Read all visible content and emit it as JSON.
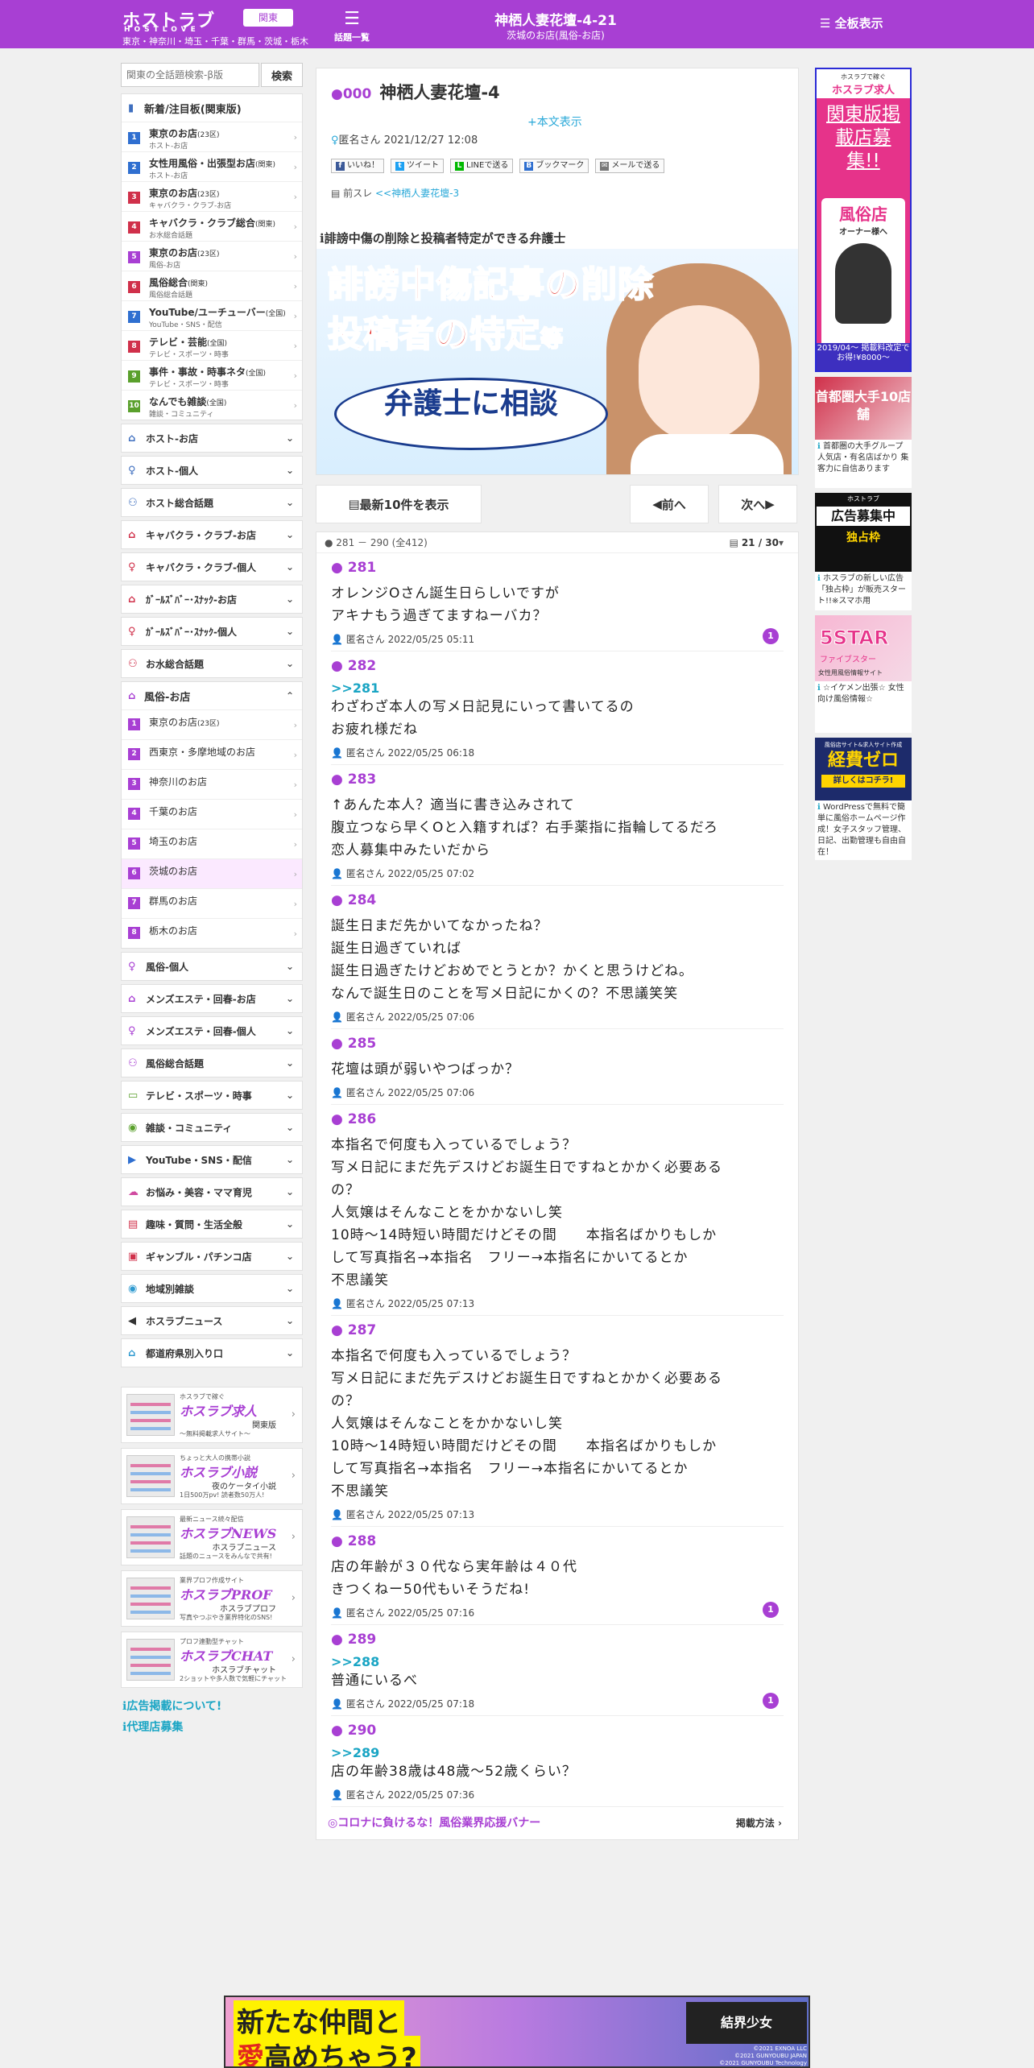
{
  "header": {
    "logo": "ホストラブ",
    "logo_sub": "HOSTLOVE",
    "region_btn": "関東",
    "cities": "東京・神奈川・埼玉・千葉・群馬・茨城・栃木",
    "topics_label": "話題一覧",
    "title": "神栖人妻花壇-4-21",
    "subtitle": "茨城のお店(風俗-お店)",
    "all_boards": "全板表示"
  },
  "search": {
    "placeholder": "関東の全話題検索-β版",
    "button": "検索"
  },
  "new_box": {
    "title": "新着/注目板(関東版)",
    "items": [
      {
        "num": "1",
        "color": "#2f6fd0",
        "title": "東京のお店",
        "tag": "(23区)",
        "sub": "ホスト-お店"
      },
      {
        "num": "2",
        "color": "#2f6fd0",
        "title": "女性用風俗・出張型お店",
        "tag": "(関東)",
        "sub": "ホスト-お店"
      },
      {
        "num": "3",
        "color": "#d0304a",
        "title": "東京のお店",
        "tag": "(23区)",
        "sub": "キャバクラ・クラブ-お店"
      },
      {
        "num": "4",
        "color": "#d0304a",
        "title": "キャバクラ・クラブ総合",
        "tag": "(関東)",
        "sub": "お水総合話題"
      },
      {
        "num": "5",
        "color": "#a83fd3",
        "title": "東京のお店",
        "tag": "(23区)",
        "sub": "風俗-お店"
      },
      {
        "num": "6",
        "color": "#d0304a",
        "title": "風俗総合",
        "tag": "(関東)",
        "sub": "風俗総合話題"
      },
      {
        "num": "7",
        "color": "#2f6fd0",
        "title": "YouTube/ユーチューバー",
        "tag": "(全国)",
        "sub": "YouTube・SNS・配信"
      },
      {
        "num": "8",
        "color": "#d0304a",
        "title": "テレビ・芸能",
        "tag": "(全国)",
        "sub": "テレビ・スポーツ・時事"
      },
      {
        "num": "9",
        "color": "#5aa02c",
        "title": "事件・事故・時事ネタ",
        "tag": "(全国)",
        "sub": "テレビ・スポーツ・時事"
      },
      {
        "num": "10",
        "color": "#5aa02c",
        "title": "なんでも雑談",
        "tag": "(全国)",
        "sub": "雑談・コミュニティ"
      }
    ]
  },
  "categories_top": [
    {
      "label": "ホスト-お店",
      "icon": "house",
      "color": "#3f6fbf"
    },
    {
      "label": "ホスト-個人",
      "icon": "person",
      "color": "#3f6fbf"
    },
    {
      "label": "ホスト総合話題",
      "icon": "group",
      "color": "#3f6fbf"
    },
    {
      "label": "キャバクラ・クラブ-お店",
      "icon": "house",
      "color": "#d0304a"
    },
    {
      "label": "キャバクラ・クラブ-個人",
      "icon": "person",
      "color": "#d0304a"
    },
    {
      "label": "ｶﾞｰﾙｽﾞﾊﾞｰ･ｽﾅｯｸ-お店",
      "icon": "house",
      "color": "#d0304a"
    },
    {
      "label": "ｶﾞｰﾙｽﾞﾊﾞｰ･ｽﾅｯｸ-個人",
      "icon": "person",
      "color": "#d0304a"
    },
    {
      "label": "お水総合話題",
      "icon": "group",
      "color": "#d0304a"
    }
  ],
  "fuzoku_box": {
    "title": "風俗-お店",
    "items": [
      {
        "num": "1",
        "title": "東京のお店",
        "tag": "(23区)"
      },
      {
        "num": "2",
        "title": "西東京・多摩地域のお店",
        "tag": ""
      },
      {
        "num": "3",
        "title": "神奈川のお店",
        "tag": ""
      },
      {
        "num": "4",
        "title": "千葉のお店",
        "tag": ""
      },
      {
        "num": "5",
        "title": "埼玉のお店",
        "tag": ""
      },
      {
        "num": "6",
        "title": "茨城のお店",
        "tag": ""
      },
      {
        "num": "7",
        "title": "群馬のお店",
        "tag": ""
      },
      {
        "num": "8",
        "title": "栃木のお店",
        "tag": ""
      }
    ]
  },
  "categories_bottom": [
    {
      "label": "風俗-個人",
      "icon": "person",
      "color": "#a83fd3"
    },
    {
      "label": "メンズエステ・回春-お店",
      "icon": "house",
      "color": "#a83fd3"
    },
    {
      "label": "メンズエステ・回春-個人",
      "icon": "person",
      "color": "#a83fd3"
    },
    {
      "label": "風俗総合話題",
      "icon": "group",
      "color": "#a83fd3"
    },
    {
      "label": "テレビ・スポーツ・時事",
      "icon": "tv",
      "color": "#5aa02c"
    },
    {
      "label": "雑談・コミュニティ",
      "icon": "chat",
      "color": "#5aa02c"
    },
    {
      "label": "YouTube・SNS・配信",
      "icon": "youtube",
      "color": "#2f6fd0"
    },
    {
      "label": "お悩み・美容・ママ育児",
      "icon": "cloud",
      "color": "#d04aa0"
    },
    {
      "label": "趣味・質問・生活全般",
      "icon": "list",
      "color": "#d0304a"
    },
    {
      "label": "ギャンブル・パチンコ店",
      "icon": "slot",
      "color": "#d0304a"
    },
    {
      "label": "地域別雑談",
      "icon": "chat",
      "color": "#2f9ad0"
    },
    {
      "label": "ホスラブニュース",
      "icon": "speaker",
      "color": "#333"
    },
    {
      "label": "都道府県別入り口",
      "icon": "house",
      "color": "#2f9ad0"
    }
  ],
  "services": [
    {
      "c1": "ホスラブで稼ぐ",
      "c2": "ホスラブ求人",
      "c3": "関東版",
      "c4": "〜無料掲載求人サイト〜"
    },
    {
      "c1": "ちょっと大人の携帯小説",
      "c2": "ホスラブ小説",
      "c3": "夜のケータイ小説",
      "c4": "1日500万pv! 読者数50万人!"
    },
    {
      "c1": "最新ニュース続々配信",
      "c2": "ホスラブNEWS",
      "c3": "ホスラブニュース",
      "c4": "話題のニュースをみんなで共有!"
    },
    {
      "c1": "業界プロフ作成サイト",
      "c2": "ホスラブPROF",
      "c3": "ホスラブプロフ",
      "c4": "写真やつぶやき業界特化のSNS!"
    },
    {
      "c1": "プロフ連動型チャット",
      "c2": "ホスラブCHAT",
      "c3": "ホスラブチャット",
      "c4": "2ショットや多人数で気軽にチャット"
    }
  ],
  "info_links": [
    "広告掲載について!",
    "代理店募集"
  ],
  "thread": {
    "id": "000",
    "title": "神栖人妻花壇-4",
    "more": "+本文表示",
    "author": "匿名さん",
    "date": "2021/12/27 12:08",
    "prev_label": "前スレ",
    "prev_link": "<<神栖人妻花壇-3",
    "socials": [
      "いいね！",
      "ツイート",
      "LINEで送る",
      "ブックマーク",
      "メールで送る"
    ]
  },
  "banner": {
    "caption": "誹謗中傷の削除と投稿者特定ができる弁護士",
    "line1": "誹謗中傷記事の削除",
    "line2": "投稿者の特定",
    "line2_suffix": "等",
    "oval": "弁護士に相談"
  },
  "nav": {
    "latest": "最新10件を表示",
    "prev": "前へ",
    "next": "次へ"
  },
  "posts_head": {
    "range": "281 － 290",
    "total": "(全412)",
    "page": "21 / 30"
  },
  "posts": [
    {
      "num": "281",
      "reply": "",
      "body": "オレンジOさん誕生日らしいですが\nアキナもう過ぎてますねーバカ？",
      "author": "匿名さん",
      "date": "2022/05/25 05:11",
      "badge": "1"
    },
    {
      "num": "282",
      "reply": ">>281",
      "body": "わざわざ本人の写メ日記見にいって書いてるの\nお疲れ様だね",
      "author": "匿名さん",
      "date": "2022/05/25 06:18",
      "badge": ""
    },
    {
      "num": "283",
      "reply": "",
      "body": "↑あんた本人？適当に書き込みされて\n腹立つなら早くOと入籍すれば？右手薬指に指輪してるだろ\n恋人募集中みたいだから",
      "author": "匿名さん",
      "date": "2022/05/25 07:02",
      "badge": ""
    },
    {
      "num": "284",
      "reply": "",
      "body": "誕生日まだ先かいてなかったね？\n誕生日過ぎていれば\n誕生日過ぎたけどおめでとうとか？かくと思うけどね。\nなんで誕生日のことを写メ日記にかくの？不思議笑笑",
      "author": "匿名さん",
      "date": "2022/05/25 07:06",
      "badge": ""
    },
    {
      "num": "285",
      "reply": "",
      "body": "花壇は頭が弱いやつばっか？",
      "author": "匿名さん",
      "date": "2022/05/25 07:06",
      "badge": ""
    },
    {
      "num": "286",
      "reply": "",
      "body": "本指名で何度も入っているでしょう？\n写メ日記にまだ先デスけどお誕生日ですねとかかく必要ある\nの？\n人気嬢はそんなことをかかないし笑\n10時〜14時短い時間だけどその間　　本指名ばかりもしか\nして写真指名→本指名　フリー→本指名にかいてるとか\n不思議笑",
      "author": "匿名さん",
      "date": "2022/05/25 07:13",
      "badge": ""
    },
    {
      "num": "287",
      "reply": "",
      "body": "本指名で何度も入っているでしょう？\n写メ日記にまだ先デスけどお誕生日ですねとかかく必要ある\nの？\n人気嬢はそんなことをかかないし笑\n10時〜14時短い時間だけどその間　　本指名ばかりもしか\nして写真指名→本指名　フリー→本指名にかいてるとか\n不思議笑",
      "author": "匿名さん",
      "date": "2022/05/25 07:13",
      "badge": ""
    },
    {
      "num": "288",
      "reply": "",
      "body": "店の年齢が３０代なら実年齢は４０代\nきつくねー50代もいそうだね!",
      "author": "匿名さん",
      "date": "2022/05/25 07:16",
      "badge": "1"
    },
    {
      "num": "289",
      "reply": ">>288",
      "body": "普通にいるべ",
      "author": "匿名さん",
      "date": "2022/05/25 07:18",
      "badge": "1"
    },
    {
      "num": "290",
      "reply": ">>289",
      "body": "店の年齢38歳は48歳〜52歳くらい？",
      "author": "匿名さん",
      "date": "2022/05/25 07:36",
      "badge": ""
    }
  ],
  "corona": {
    "text": "◎コロナに負けるな！風俗業界応援バナー",
    "method": "掲載方法"
  },
  "right_ads": [
    {
      "title_small": "ホスラブで稼ぐ",
      "brand": "ホスラブ求人",
      "head": "関東版掲載店募集!!",
      "tag": "風俗店",
      "tag2": "オーナー様へ",
      "price": "2019/04〜 掲載料改定で お得!¥8000〜",
      "caption": ""
    },
    {
      "title_small": "首都圏大手",
      "brand": "",
      "head": "首都圏大手10店舗",
      "caption": "首都圏の大手グループ 人気店・有名店ばかり 集客力に自信あります"
    },
    {
      "title_small": "独占枠",
      "brand": "ホストラブ",
      "head": "広告募集中",
      "caption": "ホスラブの新しい広告「独占枠」が販売スタート!!※スマホ用"
    },
    {
      "title_small": "女性用風俗情報サイト",
      "brand": "5STAR",
      "head": "ファイブスター",
      "caption": "☆イケメン出張☆ 女性向け風俗情報☆"
    },
    {
      "title_small": "風俗店サイト&求人サイト作成",
      "brand": "経費ゼロ",
      "head": "詳しくはコチラ!",
      "caption": "WordPressで無料で簡単に風俗ホームページ作成！女子スタッフ管理、日記、出勤管理も自由自在！"
    }
  ],
  "bottom_ad": {
    "line1": "新たな仲間と",
    "line2a": "愛",
    "line2b": "高めちゃう?",
    "logo": "結界少女",
    "copy": "©2021 EXNOA LLC\n©2021 GUNYOUBU JAPAN\n©2021 GUNYOUBU Technology"
  },
  "colors": {
    "brand": "#a83fd3",
    "link": "#1aa5c4"
  }
}
